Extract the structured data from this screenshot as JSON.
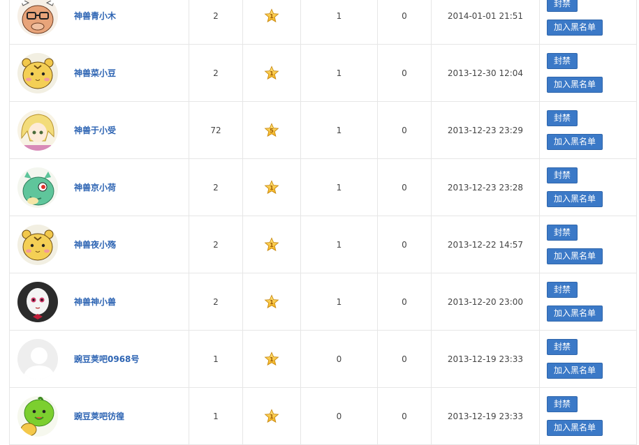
{
  "actions": {
    "ban_label": "封禁",
    "blacklist_label": "加入黑名单"
  },
  "rows": [
    {
      "name": "神兽青小木",
      "posts": "2",
      "level": "1",
      "col4": "1",
      "col5": "0",
      "time": "2014-01-01 21:51",
      "avatar": "ox-glasses"
    },
    {
      "name": "神兽菜小豆",
      "posts": "2",
      "level": "1",
      "col4": "1",
      "col5": "0",
      "time": "2013-12-30 12:04",
      "avatar": "tiger"
    },
    {
      "name": "神兽于小受",
      "posts": "72",
      "level": "5",
      "col4": "1",
      "col5": "0",
      "time": "2013-12-23 23:29",
      "avatar": "anime-girl"
    },
    {
      "name": "神兽京小荷",
      "posts": "2",
      "level": "1",
      "col4": "1",
      "col5": "0",
      "time": "2013-12-23 23:28",
      "avatar": "green-dragon"
    },
    {
      "name": "神兽夜小殇",
      "posts": "2",
      "level": "1",
      "col4": "1",
      "col5": "0",
      "time": "2013-12-22 14:57",
      "avatar": "tiger"
    },
    {
      "name": "神兽神小兽",
      "posts": "2",
      "level": "1",
      "col4": "1",
      "col5": "0",
      "time": "2013-12-20 23:00",
      "avatar": "clown"
    },
    {
      "name": "豌豆荚吧0968号",
      "posts": "1",
      "level": "1",
      "col4": "0",
      "col5": "0",
      "time": "2013-12-19 23:33",
      "avatar": "default-person"
    },
    {
      "name": "豌豆荚吧彷徨",
      "posts": "1",
      "level": "1",
      "col4": "0",
      "col5": "0",
      "time": "2013-12-19 23:33",
      "avatar": "green-pea"
    }
  ]
}
